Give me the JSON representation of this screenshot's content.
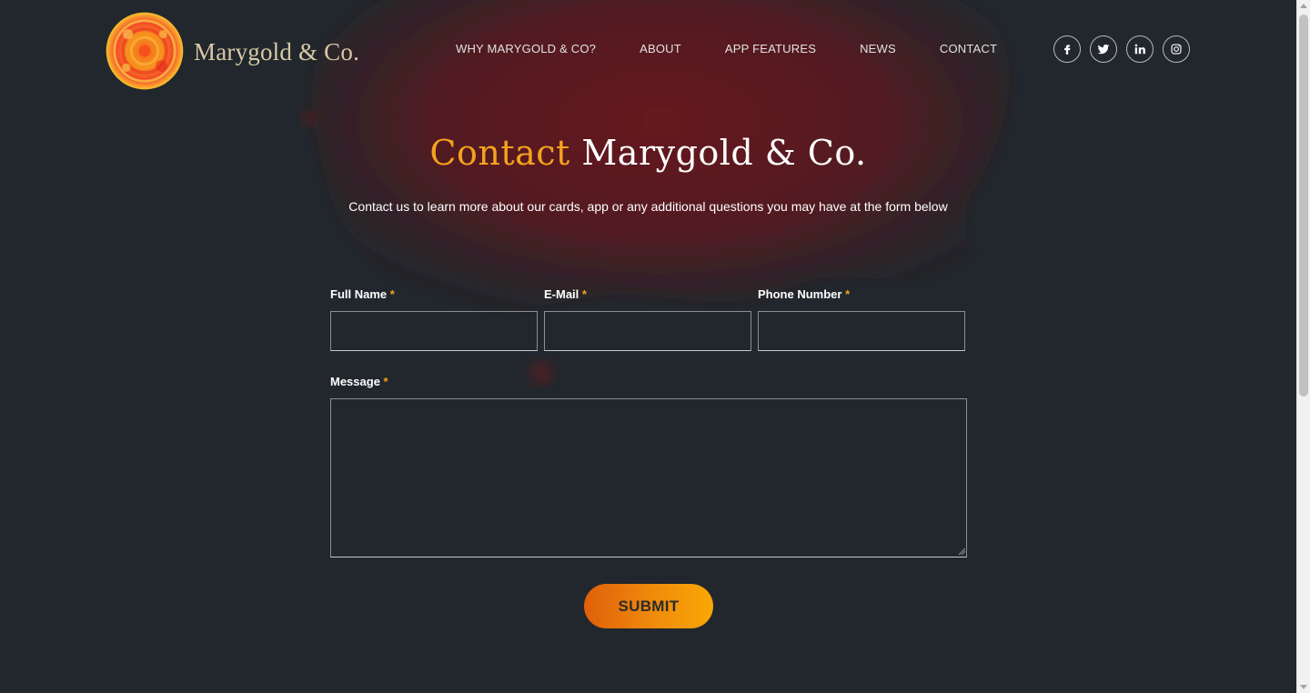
{
  "brand": {
    "name": "Marygold & Co.",
    "accent_color": "#f5a21e",
    "background_color": "#21272c"
  },
  "nav": {
    "items": [
      "WHY MARYGOLD & CO?",
      "ABOUT",
      "APP FEATURES",
      "NEWS",
      "CONTACT"
    ]
  },
  "social": {
    "icons": [
      "facebook-icon",
      "twitter-icon",
      "linkedin-icon",
      "instagram-icon"
    ]
  },
  "hero": {
    "title_accent": "Contact",
    "title_rest": " Marygold & Co.",
    "subtitle": "Contact us to learn more about our cards, app or any additional questions you may have at the form below"
  },
  "form": {
    "full_name": {
      "label": "Full Name",
      "required": "*",
      "value": ""
    },
    "email": {
      "label": "E-Mail",
      "required": "*",
      "value": ""
    },
    "phone": {
      "label": "Phone Number",
      "required": "*",
      "value": ""
    },
    "message": {
      "label": "Message",
      "required": "*",
      "value": ""
    },
    "submit_label": "SUBMIT"
  }
}
